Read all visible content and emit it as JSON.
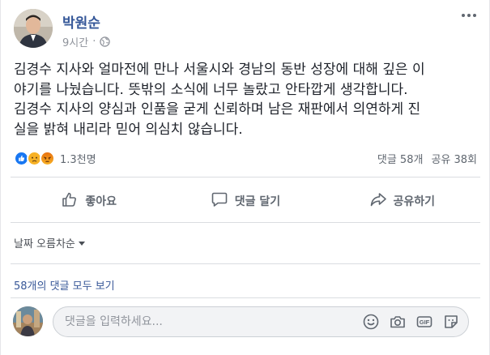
{
  "post": {
    "author": "박원순",
    "time": "9시간",
    "separator": "·",
    "text_lines": [
      "김경수 지사와 얼마전에 만나 서울시와 경남의 동반 성장에 대해 깊은 이",
      "야기를 나눴습니다. 뜻밖의 소식에 너무 놀랐고 안타깝게 생각합니다.",
      "김경수 지사의 양심과 인품을 굳게 신뢰하며 남은 재판에서 의연하게 진",
      "실을 밝혀 내리라 믿어 의심치 않습니다."
    ]
  },
  "reactions": {
    "types": [
      "like-icon",
      "sad-icon",
      "angry-icon"
    ],
    "count": "1.3천명",
    "comments": "댓글 58개",
    "shares": "공유 38회"
  },
  "actions": {
    "like": "좋아요",
    "comment": "댓글 달기",
    "share": "공유하기"
  },
  "comments_section": {
    "sort_label": "날짜 오름차순",
    "view_all": "58개의 댓글 모두 보기",
    "placeholder": "댓글을 입력하세요...",
    "gif_label": "GIF"
  },
  "colors": {
    "link": "#365899",
    "like_blue": "#1877f2",
    "angry_red": "#e9710f",
    "sad_yellow": "#f7b125",
    "muted": "#606770"
  }
}
